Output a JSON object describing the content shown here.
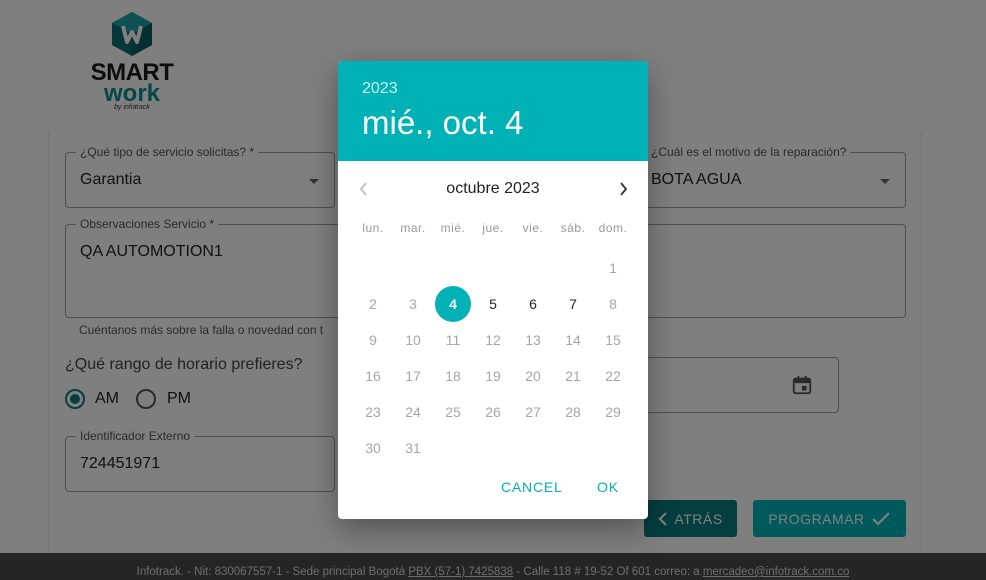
{
  "logo": {
    "line1": "SMART",
    "line2": "work",
    "line3": "by infotrack"
  },
  "form": {
    "service_type": {
      "label": "¿Qué tipo de servicio solicitas? *",
      "value": "Garantia"
    },
    "repair_reason": {
      "label": "¿Cuál es el motivo de la reparación?",
      "value": "BOTA AGUA"
    },
    "observations": {
      "label": "Observaciones Servicio *",
      "value": "QA AUTOMOTION1",
      "helper": "Cuéntanos más sobre la falla o novedad con t"
    },
    "schedule_question": "¿Qué rango de horario prefieres?",
    "radio_am": "AM",
    "radio_pm": "PM",
    "external_id": {
      "label": "Identificador Externo",
      "value": "724451971"
    },
    "back_button": "ATRÁS",
    "program_button": "PROGRAMAR"
  },
  "footer": {
    "part1": "Infotrack. - Nit: 830067557-1 - Sede principal Bogotá ",
    "phone": "PBX (57-1) 7425838",
    "part2": " - Calle 118 # 19-52 Of 601   correo: a ",
    "email": "mercadeo@infotrack.com.co"
  },
  "datepicker": {
    "year": "2023",
    "selected_label": "mié., oct. 4",
    "month_label": "octubre 2023",
    "weekdays": [
      "lun.",
      "mar.",
      "mié.",
      "jue.",
      "vie.",
      "sáb.",
      "dom."
    ],
    "weeks": [
      [
        null,
        null,
        null,
        null,
        null,
        null,
        "1"
      ],
      [
        "2",
        "3",
        "4",
        "5",
        "6",
        "7",
        "8"
      ],
      [
        "9",
        "10",
        "11",
        "12",
        "13",
        "14",
        "15"
      ],
      [
        "16",
        "17",
        "18",
        "19",
        "20",
        "21",
        "22"
      ],
      [
        "23",
        "24",
        "25",
        "26",
        "27",
        "28",
        "29"
      ],
      [
        "30",
        "31",
        null,
        null,
        null,
        null,
        null
      ]
    ],
    "enabled_days": [
      "4",
      "5",
      "6",
      "7"
    ],
    "selected_day": "4",
    "cancel_label": "CANCEL",
    "ok_label": "OK"
  },
  "colors": {
    "accent": "#00b2b6",
    "accent_dark": "#0a7d7f",
    "footer": "#4a4a4a"
  },
  "icons": {
    "prev": "chevron-left-icon",
    "next": "chevron-right-icon",
    "calendar": "calendar-icon",
    "back": "chevron-left-icon",
    "check": "check-icon",
    "dropdown": "arrow-drop-down-icon"
  }
}
